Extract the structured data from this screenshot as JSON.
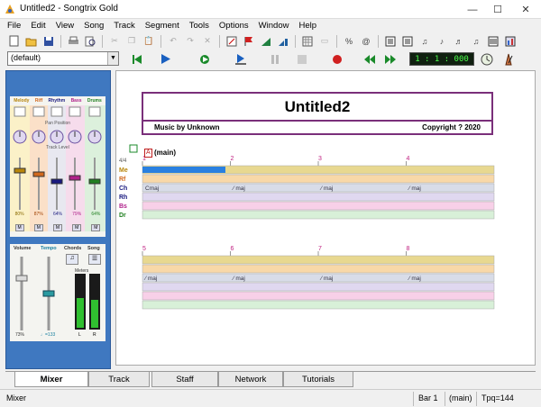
{
  "window": {
    "title": "Untitled2 - Songtrix Gold"
  },
  "menu": [
    "File",
    "Edit",
    "View",
    "Song",
    "Track",
    "Segment",
    "Tools",
    "Options",
    "Window",
    "Help"
  ],
  "toolbar2": {
    "style_select": "(default)",
    "position_display": "1 : 1 : 000"
  },
  "mixer": {
    "tracks": [
      {
        "name": "Melody",
        "color": "#b8860b",
        "level": "80%"
      },
      {
        "name": "Riff",
        "color": "#d2691e",
        "level": "87%"
      },
      {
        "name": "Rhythm",
        "color": "#1a1a80",
        "level": "64%"
      },
      {
        "name": "Bass",
        "color": "#b0208a",
        "level": "79%"
      },
      {
        "name": "Drums",
        "color": "#208020",
        "level": "64%"
      }
    ],
    "pan_label": "Pan Position",
    "level_label": "Track Level",
    "mute_label": "M",
    "volume_label": "Volume",
    "tempo_label": "Tempo",
    "chords_label": "Chords",
    "song_label": "Song",
    "meters_label": "Meters",
    "volume_value": "73%",
    "tempo_value": "♩=133",
    "meter_left": "L",
    "meter_right": "R"
  },
  "document": {
    "title": "Untitled2",
    "author": "Music by Unknown",
    "copyright": "Copyright ? 2020",
    "segment_label": "A",
    "segment_name": "(main)",
    "beat_marker": "4/4",
    "row1_bars": [
      "1",
      "2",
      "3",
      "4"
    ],
    "row2_bars": [
      "5",
      "6",
      "7",
      "8"
    ],
    "track_labels": [
      "Me",
      "Rf",
      "Ch",
      "Rh",
      "Bs",
      "Dr"
    ],
    "track_colors": [
      "#e8d890",
      "#f8d8a8",
      "#d8dce8",
      "#e0d8f0",
      "#f8d0e8",
      "#d8f0d8"
    ],
    "label_colors": [
      "#b8860b",
      "#d2691e",
      "#1a1a80",
      "#1a1a80",
      "#b0208a",
      "#208020"
    ],
    "chord_first": "Cmaj",
    "chord_repeat": "⁄ maj"
  },
  "tabs": [
    "Mixer",
    "Track",
    "Staff",
    "Network",
    "Tutorials"
  ],
  "active_tab": "Mixer",
  "status": {
    "left": "Mixer",
    "bar": "Bar 1",
    "segment": "(main)",
    "tpq": "Tpq=144"
  }
}
